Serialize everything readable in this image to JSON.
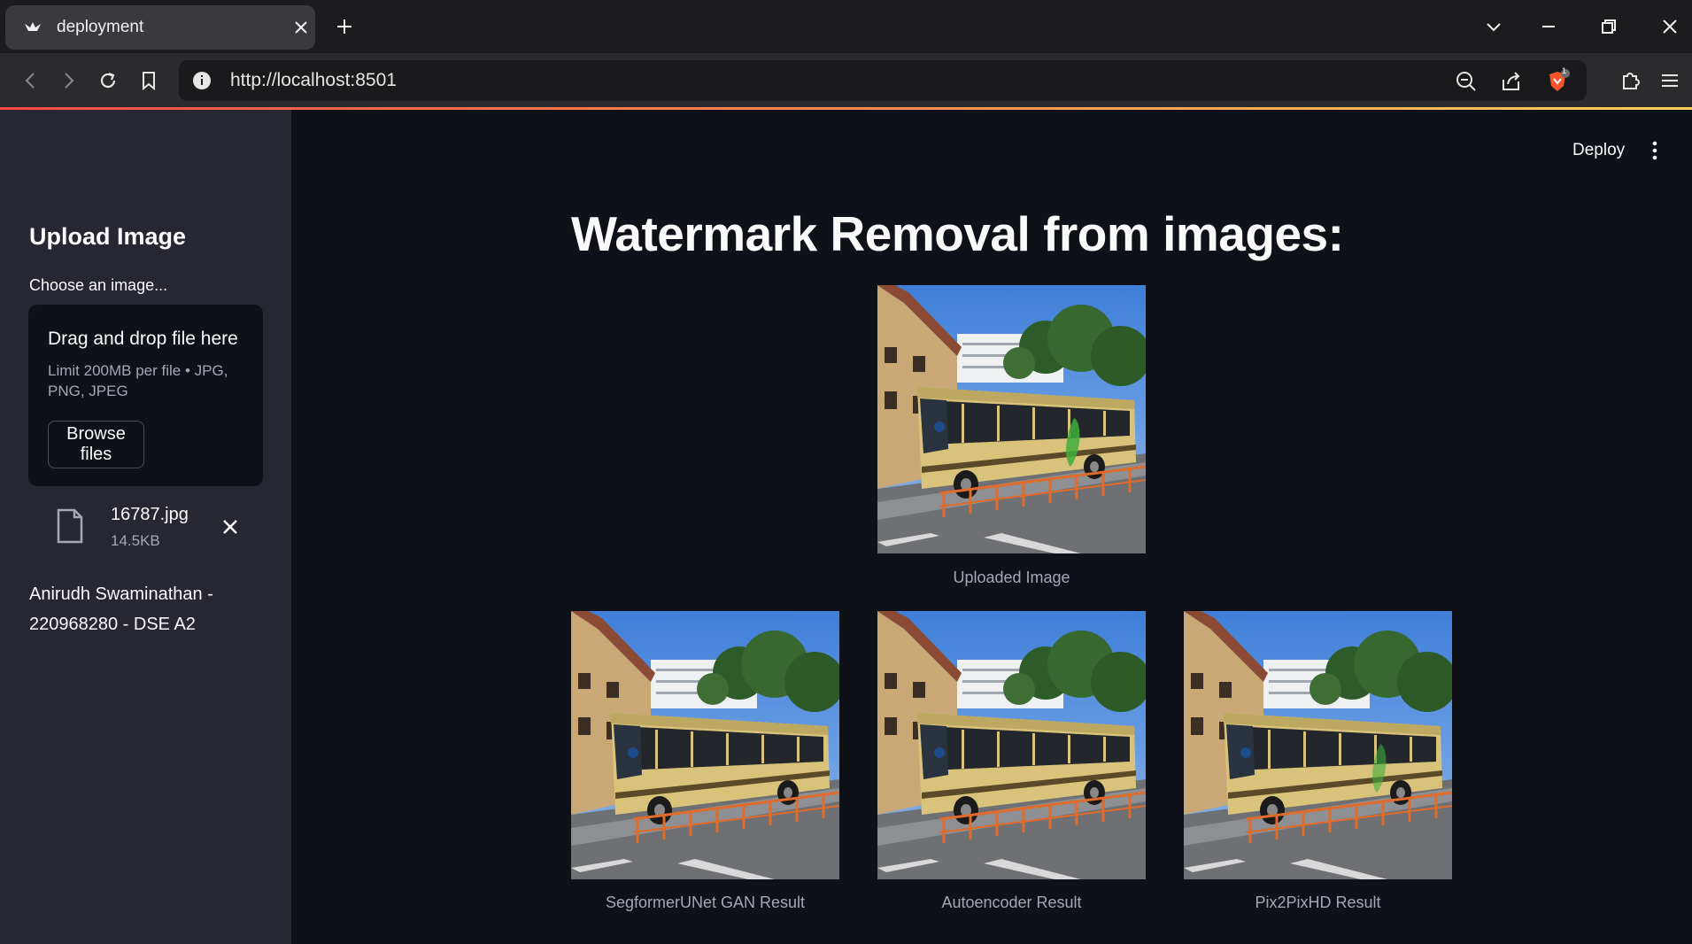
{
  "browser": {
    "tab_title": "deployment",
    "url": "http://localhost:8501",
    "notification_badge": "1"
  },
  "app": {
    "deploy_label": "Deploy",
    "page_title": "Watermark Removal from images:"
  },
  "sidebar": {
    "header": "Upload Image",
    "uploader_label": "Choose an image...",
    "dropzone_title": "Drag and drop file here",
    "dropzone_limit": "Limit 200MB per file • JPG, PNG, JPEG",
    "browse_button": "Browse files",
    "file_name": "16787.jpg",
    "file_size": "14.5KB",
    "author": "Anirudh Swaminathan - 220968280 - DSE A2"
  },
  "images": {
    "uploaded_caption": "Uploaded Image",
    "results": [
      {
        "caption": "SegformerUNet GAN Result"
      },
      {
        "caption": "Autoencoder Result"
      },
      {
        "caption": "Pix2PixHD Result"
      }
    ]
  },
  "colors": {
    "app_bg": "#0e1117",
    "sidebar_bg": "#262730",
    "accent": "#ff4b4b"
  }
}
